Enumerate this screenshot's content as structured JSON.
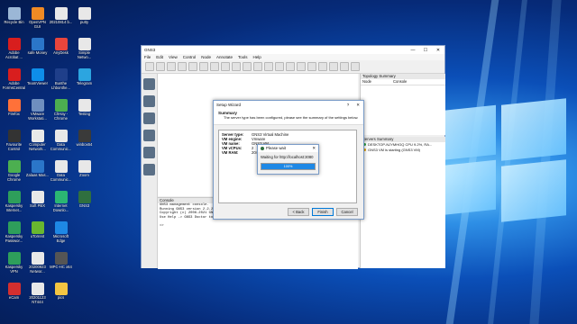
{
  "desktop": {
    "icons": [
      {
        "label": "Recycle Bin",
        "color": "#9bb7d6"
      },
      {
        "label": "OpenVPN\nGUI",
        "color": "#f08a24"
      },
      {
        "label": "20210814 b...",
        "color": "#e8e8e8"
      },
      {
        "label": "putty",
        "color": "#e8e8e8"
      },
      {
        "label": "Adobe\nAcrobat ...",
        "color": "#d81e1e"
      },
      {
        "label": "safe Money",
        "color": "#2b76c9"
      },
      {
        "label": "AnyDesk",
        "color": "#e8453c"
      },
      {
        "label": "Simple\nNetwo...",
        "color": "#e8e8e8"
      },
      {
        "label": "Adobe\nFormsCentral",
        "color": "#d81e1e"
      },
      {
        "label": "TeamViewer",
        "color": "#0e8ee9"
      },
      {
        "label": "Bunthe\nLhbonthe...",
        "color": "#1f3f8a"
      },
      {
        "label": "Telegram",
        "color": "#2ca5e0"
      },
      {
        "label": "Firefox",
        "color": "#ff7139"
      },
      {
        "label": "VMware\nWorkstati...",
        "color": "#6f8fbf"
      },
      {
        "label": "ChHay -\nChrome",
        "color": "#4caf50"
      },
      {
        "label": "Testing",
        "color": "#e8e8e8"
      },
      {
        "label": "Favourite\nControl",
        "color": "#333333"
      },
      {
        "label": "Computer\nNetwork...",
        "color": "#e8e8e8"
      },
      {
        "label": "Data\nCommunic...",
        "color": "#e8e8e8"
      },
      {
        "label": "winbox64",
        "color": "#3a3a3a"
      },
      {
        "label": "Google\nChrome",
        "color": "#4caf50"
      },
      {
        "label": "Zalaas Mas...",
        "color": "#2b76c9"
      },
      {
        "label": "Data\nCommunic...",
        "color": "#e8e8e8"
      },
      {
        "label": "Zoom",
        "color": "#e8e8e8"
      },
      {
        "label": "Kaspersky\nInternet...",
        "color": "#2e9e5b"
      },
      {
        "label": "Soft PBX",
        "color": "#e8e8e8"
      },
      {
        "label": "Internet\nDownlo...",
        "color": "#2bb673"
      },
      {
        "label": "GNS3",
        "color": "#2f6f3f"
      },
      {
        "label": "Kaspersky\nPasswor...",
        "color": "#2e9e5b"
      },
      {
        "label": "uTorrent",
        "color": "#68b72f"
      },
      {
        "label": "Microsoft\nEdge",
        "color": "#1e88e5"
      },
      {
        "label": "",
        "color": ""
      },
      {
        "label": "Kaspersky\nVPN",
        "color": "#2e9e5b"
      },
      {
        "label": "20200923\nNetwor...",
        "color": "#e8e8e8"
      },
      {
        "label": "MPC-HC x64",
        "color": "#555555"
      },
      {
        "label": "",
        "color": ""
      },
      {
        "label": "eCam",
        "color": "#d32f2f"
      },
      {
        "label": "20201123\nNT444",
        "color": "#e8e8e8"
      },
      {
        "label": "pics",
        "color": "#f4c542"
      },
      {
        "label": "",
        "color": ""
      }
    ]
  },
  "gns3": {
    "title": "GNS3",
    "window_controls": [
      "—",
      "☐",
      "✕"
    ],
    "menu": [
      "File",
      "Edit",
      "View",
      "Control",
      "Node",
      "Annotate",
      "Tools",
      "Help"
    ],
    "toolbar_icons": [
      "new-project-icon",
      "open-icon",
      "save-icon",
      "snapshot-icon",
      "clock-icon",
      "show-interfaces-icon",
      "console-all-icon",
      "start-icon",
      "pause-icon",
      "stop-icon",
      "reload-icon",
      "note-icon",
      "image-icon",
      "rectangle-icon",
      "ellipse-icon",
      "line-icon",
      "lock-icon",
      "zoom-in-icon",
      "zoom-out-icon",
      "screenshot-icon"
    ],
    "topology": {
      "header": "Topology Summary",
      "col_node": "Node",
      "col_console": "Console"
    },
    "servers": {
      "header": "Servers Summary",
      "items": [
        {
          "text": "DESKTOP-NJYMHGQ CPU 9.2%, RA...",
          "color": "#2ea043"
        },
        {
          "text": "GNS3 VM is starting (GNS3 VM)",
          "color": "#e0a000"
        }
      ]
    },
    "console": {
      "header": "Console",
      "lines": [
        "GNS3 management console.",
        "Running GNS3 version 2.2.22 on Windows (64-bit) with Python 3.7",
        "Copyright (c) 2006-2021 GNS3 Technologies.",
        "Use Help -> GNS3 Doctor to detect common issues.",
        "",
        "=>"
      ]
    }
  },
  "wizard": {
    "title": "Setup Wizard",
    "controls": [
      "?",
      "✕"
    ],
    "heading": "Summary",
    "subheading": "The server type has been configured, please see the summary of the settings below.",
    "summary": [
      {
        "key": "Server type:",
        "value": "GNS3 Virtual Machine"
      },
      {
        "key": "VM engine:",
        "value": "Vmware"
      },
      {
        "key": "VM name:",
        "value": "GNS3 VM"
      },
      {
        "key": "VM vCPUs:",
        "value": "2"
      },
      {
        "key": "VM RAM:",
        "value": "2048 MB"
      }
    ],
    "buttons": {
      "back": "< Back",
      "finish": "Finish",
      "cancel": "Cancel"
    }
  },
  "please_wait": {
    "title": "Please wait",
    "close": "✕",
    "message": "Waiting for http://localhost:3080",
    "progress_percent": 100,
    "progress_text": "100%"
  }
}
